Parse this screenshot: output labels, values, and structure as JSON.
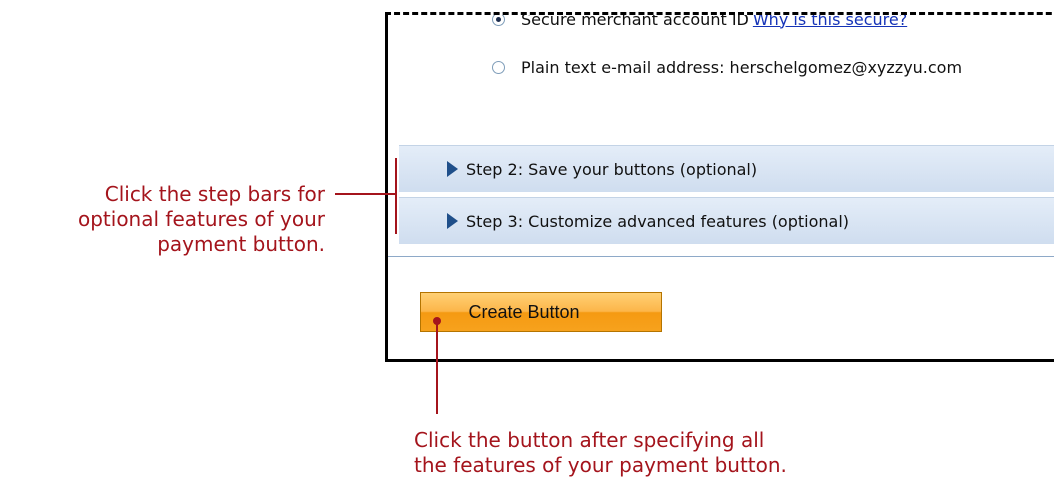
{
  "form": {
    "option_secure": "Secure merchant account ID",
    "option_secure_link": "Why is this secure?",
    "option_email": "Plain text e-mail address: herschelgomez@xyzzyu.com",
    "step2": "Step 2: Save your buttons (optional)",
    "step3": "Step 3: Customize advanced features (optional)",
    "create_button": "Create Button"
  },
  "annotations": {
    "step_bars_line1": "Click the step bars for",
    "step_bars_line2": "optional features of your",
    "step_bars_line3": "payment button.",
    "button_line1": "Click the button after specifying all",
    "button_line2": "the features of your payment button."
  },
  "colors": {
    "annotation": "#a4141c",
    "button": "#f7a21d",
    "step_bar": "#dbe6f4",
    "link": "#1533b7"
  }
}
